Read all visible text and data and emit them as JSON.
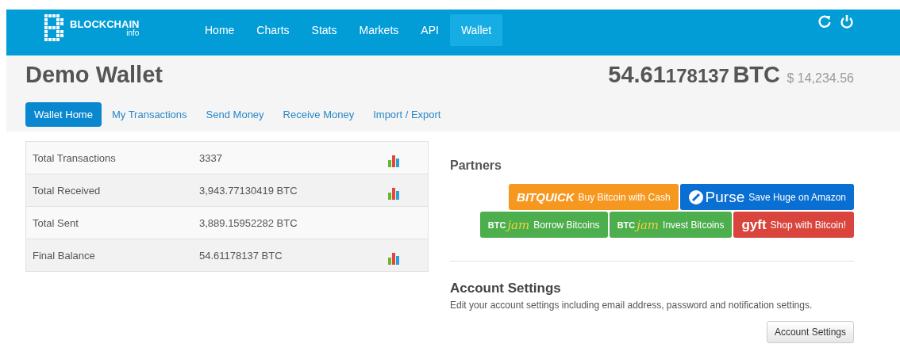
{
  "brand": {
    "name": "BLOCKCHAIN",
    "sub": "info"
  },
  "nav": [
    {
      "label": "Home",
      "selected": false
    },
    {
      "label": "Charts",
      "selected": false
    },
    {
      "label": "Stats",
      "selected": false
    },
    {
      "label": "Markets",
      "selected": false
    },
    {
      "label": "API",
      "selected": false
    },
    {
      "label": "Wallet",
      "selected": true
    }
  ],
  "header": {
    "title": "Demo Wallet",
    "balance_main": "54.61",
    "balance_rest": "178137",
    "unit": "BTC",
    "fiat": "$ 14,234.56"
  },
  "tabs": [
    {
      "label": "Wallet Home",
      "selected": true
    },
    {
      "label": "My Transactions",
      "selected": false
    },
    {
      "label": "Send Money",
      "selected": false
    },
    {
      "label": "Receive Money",
      "selected": false
    },
    {
      "label": "Import / Export",
      "selected": false
    }
  ],
  "summary": [
    {
      "label": "Total Transactions",
      "value": "3337",
      "chart_link": true
    },
    {
      "label": "Total Received",
      "value": "3,943.77130419 BTC",
      "chart_link": true
    },
    {
      "label": "Total Sent",
      "value": "3,889.15952282 BTC",
      "chart_link": false
    },
    {
      "label": "Final Balance",
      "value": "54.61178137 BTC",
      "chart_link": true
    }
  ],
  "partners": {
    "title": "Partners",
    "rows": [
      [
        {
          "kind": "bitquick",
          "logo": "BITQUICK",
          "caption": "Buy Bitcoin with Cash",
          "color": "#f6981f"
        },
        {
          "kind": "purse",
          "logo": "Purse",
          "caption": "Save Huge on Amazon",
          "color": "#0a6fd3"
        }
      ],
      [
        {
          "kind": "btcjam",
          "logo": "BTC",
          "logo_script": "jam",
          "caption": "Borrow Bitcoins",
          "color": "#4cae4c"
        },
        {
          "kind": "btcjam",
          "logo": "BTC",
          "logo_script": "jam",
          "caption": "Invest Bitcoins",
          "color": "#4cae4c"
        },
        {
          "kind": "gyft",
          "logo": "gyft",
          "caption": "Shop with Bitcoin!",
          "color": "#d9443c"
        }
      ]
    ]
  },
  "account": {
    "title": "Account Settings",
    "description": "Edit your account settings including email address, password and notification settings.",
    "button": "Account Settings"
  }
}
